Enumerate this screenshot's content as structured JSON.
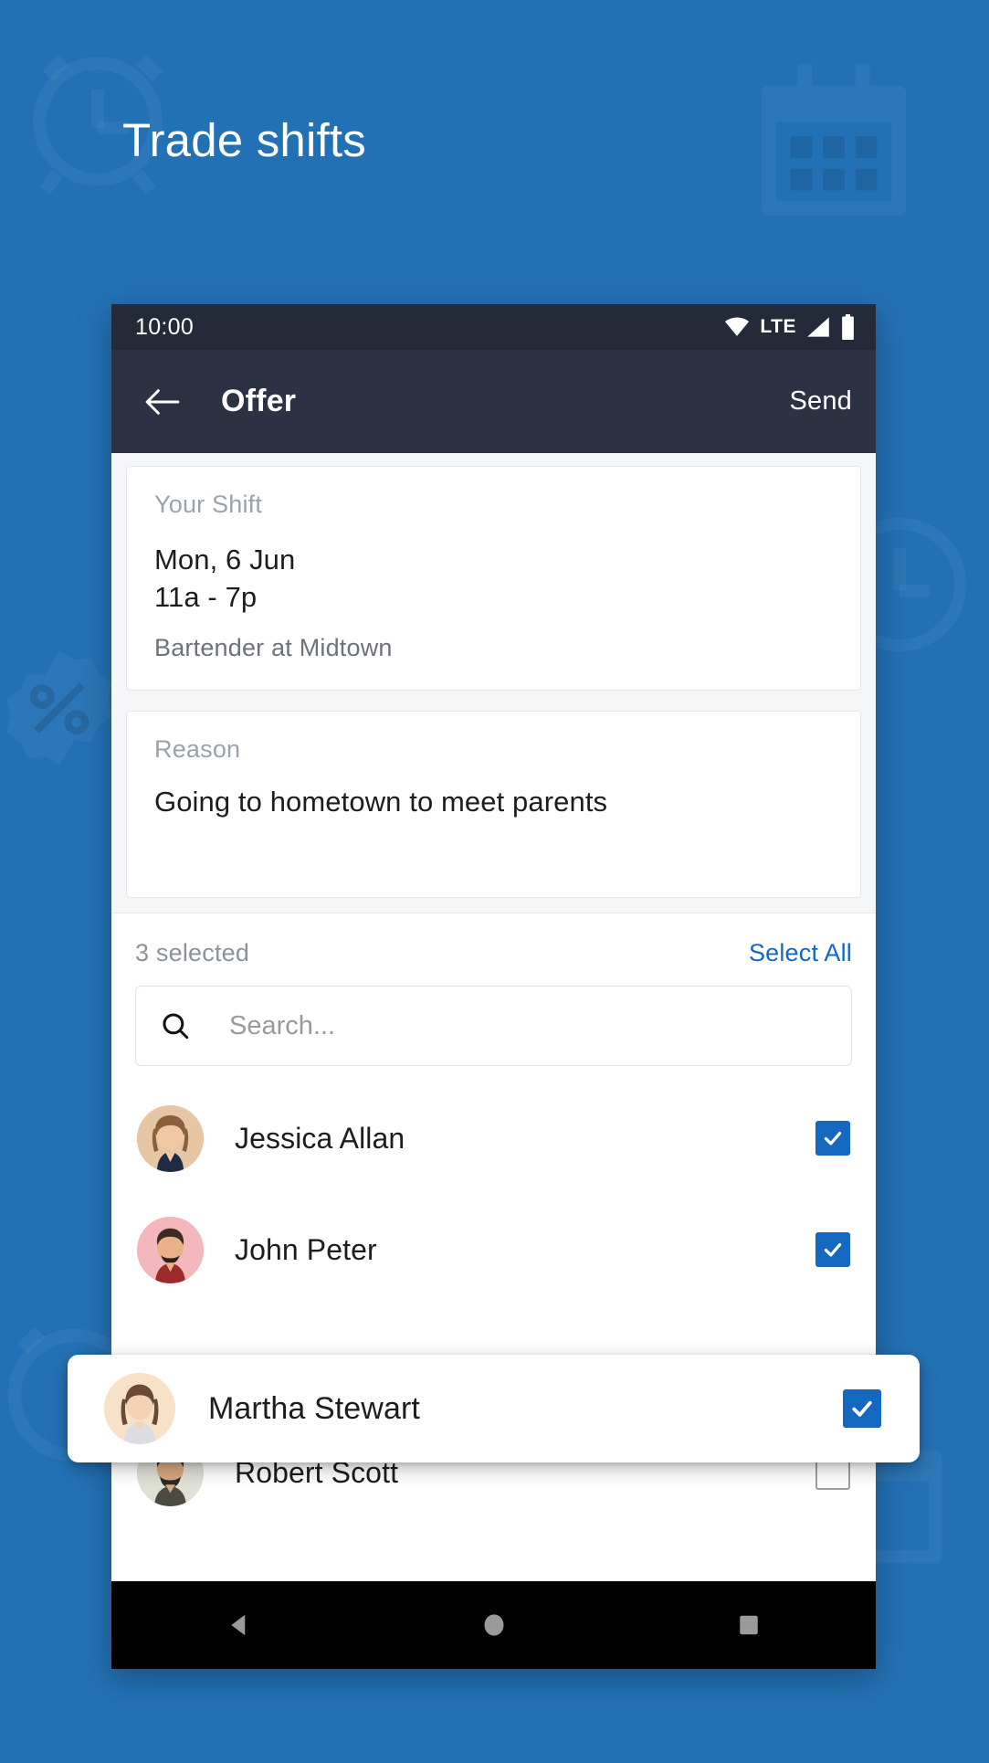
{
  "theme": {
    "background_blue": "#2371b5",
    "accent_blue": "#1568c0",
    "status_bar_bg": "#242a38",
    "app_bar_bg": "#2c3244",
    "sheet_bg": "#f5f6f7"
  },
  "page": {
    "title": "Trade shifts"
  },
  "watermarks": [
    {
      "name": "alarm-clock-watermark"
    },
    {
      "name": "calendar-watermark"
    },
    {
      "name": "percent-badge-watermark"
    },
    {
      "name": "clock-watermark"
    },
    {
      "name": "alarm-clock-watermark-2"
    }
  ],
  "status_bar": {
    "time": "10:00",
    "network_label": "LTE",
    "icons": [
      "wifi-icon",
      "signal-icon",
      "battery-icon"
    ]
  },
  "app_bar": {
    "back_icon": "back-arrow-icon",
    "title": "Offer",
    "action_label": "Send"
  },
  "shift_card": {
    "label": "Your Shift",
    "date": "Mon, 6 Jun",
    "time": "11a - 7p",
    "role": "Bartender at Midtown"
  },
  "reason_card": {
    "label": "Reason",
    "value": "Going to hometown to meet parents"
  },
  "selection": {
    "count_label": "3 selected",
    "select_all_label": "Select All"
  },
  "search": {
    "placeholder": "Search...",
    "value": "",
    "icon": "search-icon"
  },
  "people": [
    {
      "name": "Jessica Allan",
      "checked": true,
      "avatar_bg": "#e6c6a4",
      "hair": "#8a5f3c",
      "skin": "#f0c9a4",
      "shirt": "#1f2a44"
    },
    {
      "name": "John Peter",
      "checked": true,
      "avatar_bg": "#f4b7bb",
      "hair": "#3b2b22",
      "skin": "#e8b189",
      "shirt": "#9e2b2b"
    },
    {
      "name": "Martha Stewart",
      "checked": true,
      "avatar_bg": "#f7e2c8",
      "hair": "#6b4a35",
      "skin": "#f2d3b6",
      "shirt": "#dcdde0"
    },
    {
      "name": "Robert Scott",
      "checked": false,
      "avatar_bg": "#dfe0d6",
      "hair": "#2e2a26",
      "skin": "#d8a982",
      "shirt": "#4c4a42"
    }
  ],
  "nav_bar": {
    "buttons": [
      "back-nav-icon",
      "home-nav-icon",
      "recents-nav-icon"
    ]
  }
}
